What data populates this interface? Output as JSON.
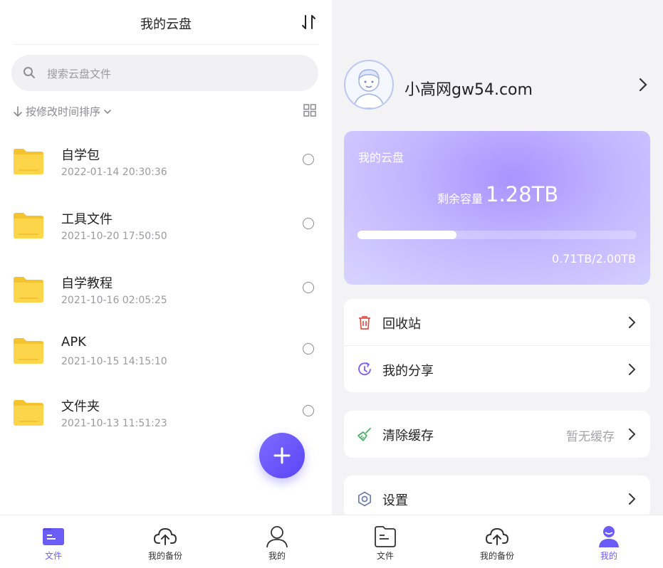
{
  "left": {
    "title": "我的云盘",
    "search_placeholder": "搜索云盘文件",
    "sort_label": "按修改时间排序",
    "files": [
      {
        "name": "自学包",
        "date": "2022-01-14 20:30:36"
      },
      {
        "name": "工具文件",
        "date": "2021-10-20 17:50:50"
      },
      {
        "name": "自学教程",
        "date": "2021-10-16 02:05:25"
      },
      {
        "name": "APK",
        "date": "2021-10-15 14:15:10"
      },
      {
        "name": "文件夹",
        "date": "2021-10-13 11:51:23"
      }
    ],
    "tabs": [
      {
        "label": "文件",
        "icon": "file-icon",
        "active": true
      },
      {
        "label": "我的备份",
        "icon": "cloud-upload-icon",
        "active": false
      },
      {
        "label": "我的",
        "icon": "user-icon",
        "active": false
      }
    ]
  },
  "right": {
    "username": "小高网gw54.com",
    "storage": {
      "title": "我的云盘",
      "remaining_label": "剩余容量",
      "remaining_value": "1.28TB",
      "usage_text": "0.71TB/2.00TB",
      "used_fraction": 0.355
    },
    "menu_groups": [
      [
        {
          "label": "回收站",
          "icon": "trash-icon"
        },
        {
          "label": "我的分享",
          "icon": "share-icon"
        }
      ],
      [
        {
          "label": "清除缓存",
          "icon": "broom-icon",
          "extra": "暂无缓存"
        }
      ],
      [
        {
          "label": "设置",
          "icon": "settings-icon"
        }
      ]
    ],
    "tabs": [
      {
        "label": "文件",
        "icon": "file-icon",
        "active": false
      },
      {
        "label": "我的备份",
        "icon": "cloud-upload-icon",
        "active": false
      },
      {
        "label": "我的",
        "icon": "user-icon",
        "active": true
      }
    ]
  },
  "colors": {
    "accent": "#6c5cf6",
    "folder": "#fdd54a",
    "trash": "#e0524a",
    "share": "#7a5cf0",
    "broom": "#4caf6a"
  }
}
